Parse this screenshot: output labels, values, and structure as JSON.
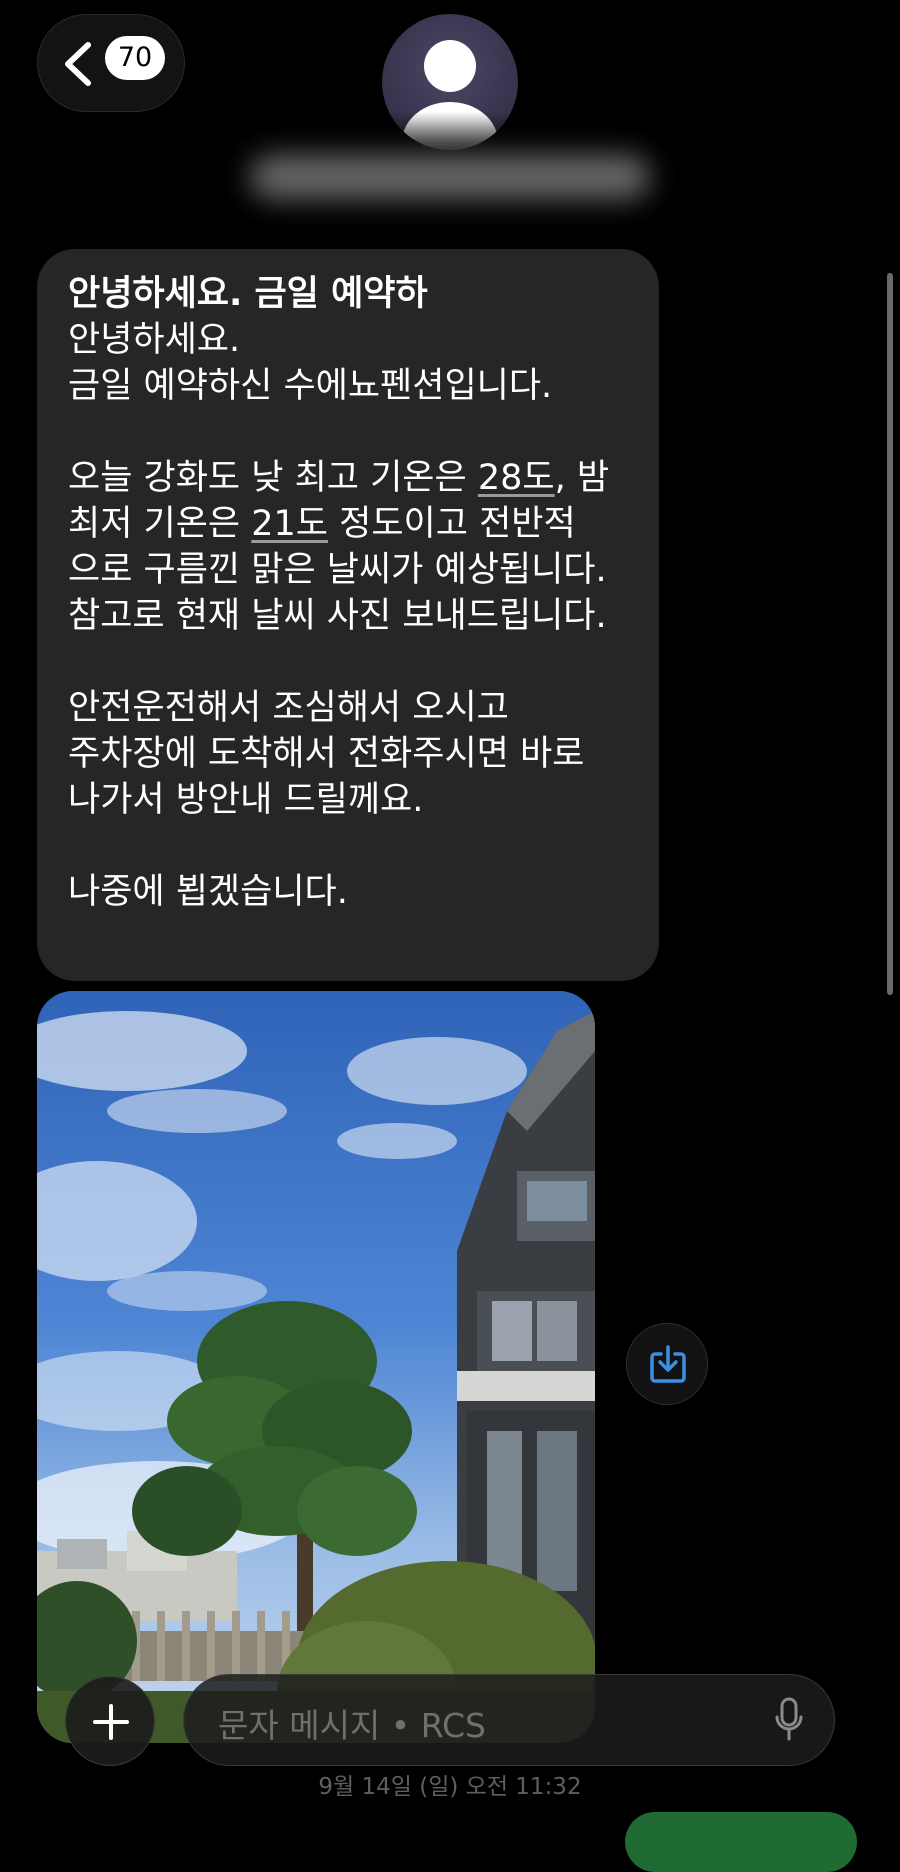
{
  "header": {
    "back_badge_count": "70",
    "contact_avatar_icon": "person-icon"
  },
  "message": {
    "subject": "안녕하세요. 금일 예약하",
    "line1": "안녕하세요.",
    "line2": "금일 예약하신 수에뇨펜션입니다.",
    "line3_pre": "오늘 강화도 낮 최고 기온은 ",
    "line3_link": "28도",
    "line3_post": ", 밤",
    "line4_pre": "최저 기온은 ",
    "line4_link": "21도",
    "line4_post": " 정도이고 전반적",
    "line5": "으로 구름낀 맑은 날씨가 예상됩니다.",
    "line6": "참고로 현재 날씨 사진 보내드립니다.",
    "line7": "안전운전해서 조심해서 오시고",
    "line8": "주차장에 도착해서 전화주시면 바로",
    "line9": "나가서 방안내 드릴께요.",
    "line10": "나중에 뵙겠습니다."
  },
  "photo": {
    "icon": "download-icon"
  },
  "timestamp": "9월 14일 (일) 오전 11:32",
  "composer": {
    "placeholder": "문자 메시지 • RCS",
    "plus_icon": "plus-icon",
    "mic_icon": "microphone-icon"
  },
  "colors": {
    "background": "#000000",
    "bubble": "#262628",
    "accent_blue": "#3a8ee6",
    "avatar": "#3c3852"
  }
}
